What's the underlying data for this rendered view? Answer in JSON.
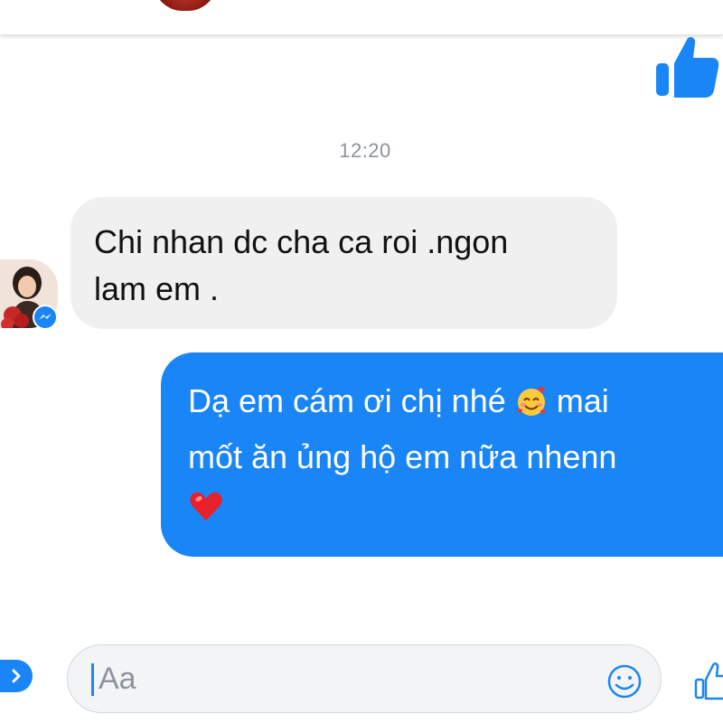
{
  "conversation": {
    "timestamp": "12:20",
    "incoming_message": {
      "lines": [
        "Chi nhan dc cha ca roi .ngon",
        "lam em ."
      ]
    },
    "outgoing_message": {
      "line1_text": "Dạ em cám ơi chị nhé",
      "line1_emoji": "smiling-face-with-hearts",
      "line1_suffix": "mai",
      "line2_text": "mốt ăn ủng hộ em nữa nhenn",
      "line3_emoji": "red-heart"
    }
  },
  "composer": {
    "placeholder": "Aa"
  },
  "icons": {
    "like": "thumbs-up-icon",
    "emoji": "smile-icon",
    "next": "chevron-right-icon",
    "badge": "messenger-icon"
  },
  "colors": {
    "accent": "#1a85f7",
    "incoming_bubble": "#f1f0f0",
    "timestamp": "#8d949e"
  }
}
